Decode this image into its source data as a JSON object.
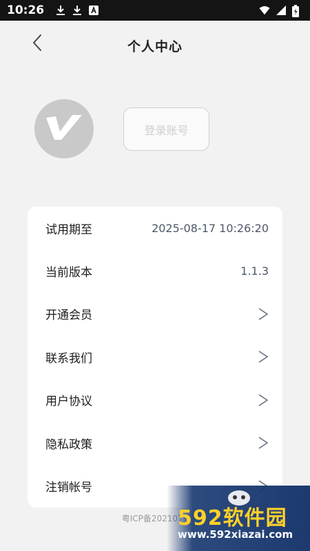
{
  "status_bar": {
    "time": "10:26",
    "left_icons": [
      "download-icon",
      "download-icon",
      "a-icon"
    ],
    "right_icons": [
      "wifi-icon",
      "signal-icon",
      "battery-icon"
    ]
  },
  "header": {
    "title": "个人中心",
    "back_icon": "chevron-left-icon"
  },
  "profile": {
    "avatar_icon": "v-logo-icon",
    "login_label": "登录账号"
  },
  "settings": [
    {
      "label": "试用期至",
      "value": "2025-08-17 10:26:20"
    },
    {
      "label": "当前版本",
      "value": "1.1.3"
    },
    {
      "label": "开通会员",
      "value": ">"
    },
    {
      "label": "联系我们",
      "value": ">"
    },
    {
      "label": "用户协议",
      "value": ">"
    },
    {
      "label": "隐私政策",
      "value": ">"
    },
    {
      "label": "注销帐号",
      "value": ">"
    }
  ],
  "footer": {
    "icp": "粤ICP备2021079"
  },
  "watermark": {
    "logo": "592软件园",
    "url": "www.592xiazai.com"
  },
  "colors": {
    "background": "#f2f2f2",
    "status_bar": "#141414",
    "value_text": "#4d5868",
    "watermark_yellow": "#ffd02a"
  }
}
